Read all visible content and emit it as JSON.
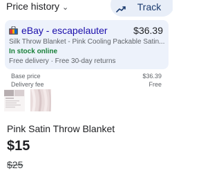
{
  "header": {
    "price_history_label": "Price history",
    "chevron_icon": "chevron-down-icon",
    "track_label": "Track",
    "track_icon": "trending-up-icon"
  },
  "offer": {
    "seller_icon": "shopping-bag-icon",
    "seller": "eBay - escapelauter",
    "price": "$36.39",
    "title": "Silk Throw Blanket - Pink Cooling Packable Satin...",
    "stock": "In stock online",
    "delivery": "Free delivery · Free 30-day returns"
  },
  "breakdown": {
    "base_label": "Base price",
    "base_value": "$36.39",
    "delivery_label": "Delivery fee",
    "delivery_value": "Free"
  },
  "product": {
    "title": "Pink Satin Throw Blanket",
    "price": "$15",
    "old_price": "$25"
  },
  "colors": {
    "card_bg": "#edf2fb",
    "seller_link": "#1a0dab",
    "stock_green": "#188038",
    "track_bg": "#e8eef8"
  }
}
